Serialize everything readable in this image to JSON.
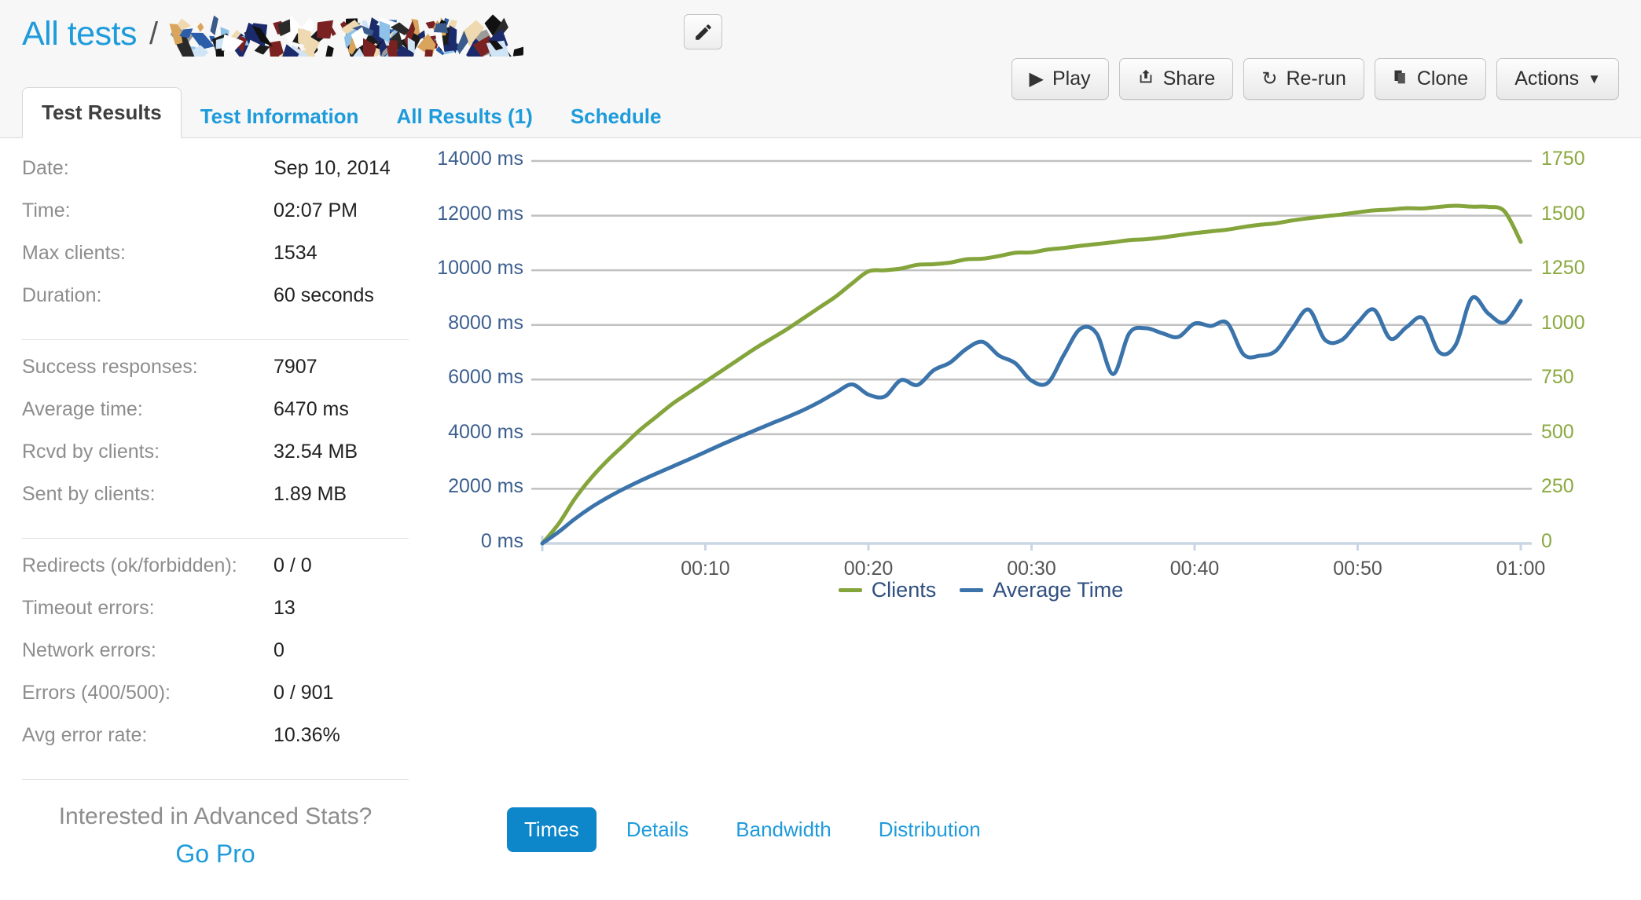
{
  "header": {
    "title": "All tests",
    "separator": "/",
    "redacted_name": "",
    "edit_icon": "pencil-icon",
    "actions": [
      {
        "label": "Play",
        "icon": "play-icon"
      },
      {
        "label": "Share",
        "icon": "share-icon"
      },
      {
        "label": "Re-run",
        "icon": "refresh-icon"
      },
      {
        "label": "Clone",
        "icon": "copy-icon"
      },
      {
        "label": "Actions",
        "icon": "chevron-down-icon"
      }
    ],
    "tabs": [
      {
        "label": "Test Results",
        "active": true
      },
      {
        "label": "Test Information",
        "active": false
      },
      {
        "label": "All Results (1)",
        "active": false
      },
      {
        "label": "Schedule",
        "active": false
      }
    ]
  },
  "stats": {
    "group1": [
      {
        "label": "Date:",
        "value": "Sep 10, 2014"
      },
      {
        "label": "Time:",
        "value": "02:07 PM"
      },
      {
        "label": "Max clients:",
        "value": "1534"
      },
      {
        "label": "Duration:",
        "value": "60 seconds"
      }
    ],
    "group2": [
      {
        "label": "Success responses:",
        "value": "7907"
      },
      {
        "label": "Average time:",
        "value": "6470 ms"
      },
      {
        "label": "Rcvd by clients:",
        "value": "32.54 MB"
      },
      {
        "label": "Sent by clients:",
        "value": "1.89 MB"
      }
    ],
    "group3": [
      {
        "label": "Redirects (ok/forbidden):",
        "value": "0 / 0"
      },
      {
        "label": "Timeout errors:",
        "value": "13"
      },
      {
        "label": "Network errors:",
        "value": "0"
      },
      {
        "label": "Errors (400/500):",
        "value": "0 / 901"
      },
      {
        "label": "Avg error rate:",
        "value": "10.36%"
      }
    ],
    "promo_text": "Interested in Advanced Stats?",
    "promo_link": "Go Pro"
  },
  "view_tabs": [
    {
      "label": "Times",
      "active": true
    },
    {
      "label": "Details",
      "active": false
    },
    {
      "label": "Bandwidth",
      "active": false
    },
    {
      "label": "Distribution",
      "active": false
    }
  ],
  "colors": {
    "brand_blue": "#1e9bdb",
    "active_pill": "#0e86ca",
    "clients_green": "#84a43c",
    "avgtime_blue": "#3b73ab",
    "left_axis_label": "#3c5f8f",
    "right_axis_label": "#8aa93f",
    "gridline": "#c0c0c0",
    "header_bg": "#f7f7f7"
  },
  "chart_data": {
    "type": "line",
    "title": "",
    "xlabel": "",
    "grid": true,
    "legend_position": "bottom",
    "x_ticks": [
      "00:10",
      "00:20",
      "00:30",
      "00:40",
      "00:50",
      "01:00"
    ],
    "x_tick_seconds": [
      10,
      20,
      30,
      40,
      50,
      60
    ],
    "xlim": [
      0,
      60
    ],
    "axes": [
      {
        "id": "left",
        "label": "Average Time",
        "unit": "ms",
        "ylim": [
          0,
          14000
        ],
        "tick_step": 2000,
        "tick_labels": [
          "0 ms",
          "2000 ms",
          "4000 ms",
          "6000 ms",
          "8000 ms",
          "10000 ms",
          "12000 ms",
          "14000 ms"
        ],
        "tick_values": [
          0,
          2000,
          4000,
          6000,
          8000,
          10000,
          12000,
          14000
        ],
        "color": "#3c5f8f"
      },
      {
        "id": "right",
        "label": "Clients",
        "unit": "",
        "ylim": [
          0,
          1750
        ],
        "tick_step": 250,
        "tick_labels": [
          "0",
          "250",
          "500",
          "750",
          "1000",
          "1250",
          "1500",
          "1750"
        ],
        "tick_values": [
          0,
          250,
          500,
          750,
          1000,
          1250,
          1500,
          1750
        ],
        "color": "#8aa93f"
      }
    ],
    "series": [
      {
        "name": "Clients",
        "axis": "right",
        "color": "#84a43c",
        "x": [
          0,
          1,
          2,
          3,
          4,
          5,
          6,
          7,
          8,
          9,
          10,
          11,
          12,
          13,
          14,
          15,
          16,
          17,
          18,
          19,
          20,
          21,
          22,
          23,
          24,
          25,
          26,
          27,
          28,
          29,
          30,
          31,
          32,
          33,
          34,
          35,
          36,
          37,
          38,
          39,
          40,
          41,
          42,
          43,
          44,
          45,
          46,
          47,
          48,
          49,
          50,
          51,
          52,
          53,
          54,
          55,
          56,
          57,
          58,
          59,
          60
        ],
        "values": [
          0,
          90,
          205,
          300,
          380,
          450,
          520,
          580,
          640,
          690,
          740,
          790,
          840,
          890,
          935,
          980,
          1030,
          1080,
          1130,
          1190,
          1245,
          1250,
          1258,
          1275,
          1278,
          1285,
          1300,
          1303,
          1315,
          1330,
          1332,
          1345,
          1352,
          1362,
          1370,
          1378,
          1388,
          1392,
          1400,
          1410,
          1420,
          1428,
          1436,
          1448,
          1458,
          1465,
          1478,
          1488,
          1497,
          1505,
          1515,
          1524,
          1528,
          1534,
          1533,
          1540,
          1545,
          1541,
          1540,
          1520,
          1380
        ]
      },
      {
        "name": "Average Time",
        "axis": "left",
        "color": "#3b73ab",
        "x": [
          0,
          1,
          2,
          3,
          4,
          5,
          6,
          7,
          8,
          9,
          10,
          11,
          12,
          13,
          14,
          15,
          16,
          17,
          18,
          19,
          20,
          21,
          22,
          23,
          24,
          25,
          26,
          27,
          28,
          29,
          30,
          31,
          32,
          33,
          34,
          35,
          36,
          37,
          38,
          39,
          40,
          41,
          42,
          43,
          44,
          45,
          46,
          47,
          48,
          49,
          50,
          51,
          52,
          53,
          54,
          55,
          56,
          57,
          58,
          59,
          60
        ],
        "values": [
          0,
          420,
          900,
          1320,
          1680,
          2000,
          2290,
          2560,
          2820,
          3080,
          3350,
          3620,
          3880,
          4130,
          4380,
          4620,
          4880,
          5180,
          5520,
          5820,
          5450,
          5380,
          5980,
          5800,
          6340,
          6620,
          7120,
          7380,
          6880,
          6600,
          5960,
          5880,
          6920,
          7860,
          7680,
          6200,
          7700,
          7880,
          7700,
          7560,
          8050,
          7960,
          8070,
          6920,
          6870,
          7060,
          7880,
          8560,
          7450,
          7440,
          8080,
          8560,
          7500,
          7920,
          8250,
          7000,
          7260,
          8980,
          8420,
          8090,
          8880
        ]
      }
    ]
  }
}
